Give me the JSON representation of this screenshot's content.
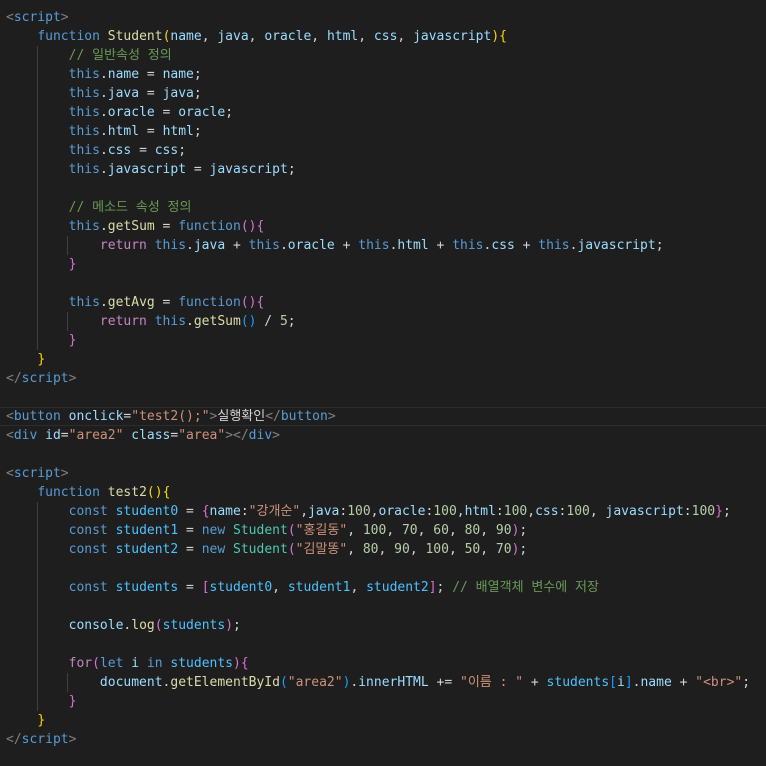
{
  "editor": {
    "language": "html",
    "colors": {
      "background": "#1e1e1e",
      "foreground": "#d4d4d4",
      "tag": "#569cd6",
      "bracket": "#808080",
      "keyword": "#569cd6",
      "control": "#c586c0",
      "function": "#dcdcaa",
      "type": "#4ec9b0",
      "variable": "#9cdcfe",
      "constant": "#4fc1ff",
      "string": "#ce9178",
      "number": "#b5cea8",
      "comment": "#6a9955",
      "paren1": "#ffd700",
      "paren2": "#da70d6",
      "paren3": "#179fff"
    },
    "lines": [
      {
        "indent": 0,
        "tokens": [
          [
            "br",
            "<"
          ],
          [
            "tag",
            "script"
          ],
          [
            "br",
            ">"
          ]
        ]
      },
      {
        "indent": 1,
        "tokens": [
          [
            "kw",
            "function "
          ],
          [
            "fn",
            "Student"
          ],
          [
            "p1",
            "("
          ],
          [
            "var",
            "name"
          ],
          [
            "op",
            ", "
          ],
          [
            "var",
            "java"
          ],
          [
            "op",
            ", "
          ],
          [
            "var",
            "oracle"
          ],
          [
            "op",
            ", "
          ],
          [
            "var",
            "html"
          ],
          [
            "op",
            ", "
          ],
          [
            "var",
            "css"
          ],
          [
            "op",
            ", "
          ],
          [
            "var",
            "javascript"
          ],
          [
            "p1",
            ")"
          ],
          [
            "p1",
            "{"
          ]
        ]
      },
      {
        "indent": 2,
        "tokens": [
          [
            "cmt",
            "// 일반속성 정의"
          ]
        ]
      },
      {
        "indent": 2,
        "tokens": [
          [
            "kw",
            "this"
          ],
          [
            "op",
            "."
          ],
          [
            "var",
            "name"
          ],
          [
            "op",
            " = "
          ],
          [
            "var",
            "name"
          ],
          [
            "op",
            ";"
          ]
        ]
      },
      {
        "indent": 2,
        "tokens": [
          [
            "kw",
            "this"
          ],
          [
            "op",
            "."
          ],
          [
            "var",
            "java"
          ],
          [
            "op",
            " = "
          ],
          [
            "var",
            "java"
          ],
          [
            "op",
            ";"
          ]
        ]
      },
      {
        "indent": 2,
        "tokens": [
          [
            "kw",
            "this"
          ],
          [
            "op",
            "."
          ],
          [
            "var",
            "oracle"
          ],
          [
            "op",
            " = "
          ],
          [
            "var",
            "oracle"
          ],
          [
            "op",
            ";"
          ]
        ]
      },
      {
        "indent": 2,
        "tokens": [
          [
            "kw",
            "this"
          ],
          [
            "op",
            "."
          ],
          [
            "var",
            "html"
          ],
          [
            "op",
            " = "
          ],
          [
            "var",
            "html"
          ],
          [
            "op",
            ";"
          ]
        ]
      },
      {
        "indent": 2,
        "tokens": [
          [
            "kw",
            "this"
          ],
          [
            "op",
            "."
          ],
          [
            "var",
            "css"
          ],
          [
            "op",
            " = "
          ],
          [
            "var",
            "css"
          ],
          [
            "op",
            ";"
          ]
        ]
      },
      {
        "indent": 2,
        "tokens": [
          [
            "kw",
            "this"
          ],
          [
            "op",
            "."
          ],
          [
            "var",
            "javascript"
          ],
          [
            "op",
            " = "
          ],
          [
            "var",
            "javascript"
          ],
          [
            "op",
            ";"
          ]
        ]
      },
      {
        "indent": 2,
        "tokens": []
      },
      {
        "indent": 2,
        "tokens": [
          [
            "cmt",
            "// 메소드 속성 정의"
          ]
        ]
      },
      {
        "indent": 2,
        "tokens": [
          [
            "kw",
            "this"
          ],
          [
            "op",
            "."
          ],
          [
            "fn",
            "getSum"
          ],
          [
            "op",
            " = "
          ],
          [
            "kw",
            "function"
          ],
          [
            "p2",
            "("
          ],
          [
            "p2",
            ")"
          ],
          [
            "p2",
            "{"
          ]
        ]
      },
      {
        "indent": 3,
        "tokens": [
          [
            "ctl",
            "return "
          ],
          [
            "kw",
            "this"
          ],
          [
            "op",
            "."
          ],
          [
            "var",
            "java"
          ],
          [
            "op",
            " + "
          ],
          [
            "kw",
            "this"
          ],
          [
            "op",
            "."
          ],
          [
            "var",
            "oracle"
          ],
          [
            "op",
            " + "
          ],
          [
            "kw",
            "this"
          ],
          [
            "op",
            "."
          ],
          [
            "var",
            "html"
          ],
          [
            "op",
            " + "
          ],
          [
            "kw",
            "this"
          ],
          [
            "op",
            "."
          ],
          [
            "var",
            "css"
          ],
          [
            "op",
            " + "
          ],
          [
            "kw",
            "this"
          ],
          [
            "op",
            "."
          ],
          [
            "var",
            "javascript"
          ],
          [
            "op",
            ";"
          ]
        ]
      },
      {
        "indent": 2,
        "tokens": [
          [
            "p2",
            "}"
          ]
        ]
      },
      {
        "indent": 2,
        "tokens": []
      },
      {
        "indent": 2,
        "tokens": [
          [
            "kw",
            "this"
          ],
          [
            "op",
            "."
          ],
          [
            "fn",
            "getAvg"
          ],
          [
            "op",
            " = "
          ],
          [
            "kw",
            "function"
          ],
          [
            "p2",
            "("
          ],
          [
            "p2",
            ")"
          ],
          [
            "p2",
            "{"
          ]
        ]
      },
      {
        "indent": 3,
        "tokens": [
          [
            "ctl",
            "return "
          ],
          [
            "kw",
            "this"
          ],
          [
            "op",
            "."
          ],
          [
            "fn",
            "getSum"
          ],
          [
            "p3",
            "("
          ],
          [
            "p3",
            ")"
          ],
          [
            "op",
            " / "
          ],
          [
            "num",
            "5"
          ],
          [
            "op",
            ";"
          ]
        ]
      },
      {
        "indent": 2,
        "tokens": [
          [
            "p2",
            "}"
          ]
        ]
      },
      {
        "indent": 1,
        "tokens": [
          [
            "p1",
            "}"
          ]
        ]
      },
      {
        "indent": 0,
        "tokens": [
          [
            "br",
            "</"
          ],
          [
            "tag",
            "script"
          ],
          [
            "br",
            ">"
          ]
        ]
      },
      {
        "indent": 0,
        "tokens": []
      },
      {
        "indent": 0,
        "current": true,
        "tokens": [
          [
            "br",
            "<"
          ],
          [
            "tag",
            "button"
          ],
          [
            "op",
            " "
          ],
          [
            "attr",
            "onclick"
          ],
          [
            "op",
            "="
          ],
          [
            "str",
            "\"test2();\""
          ],
          [
            "br",
            ">"
          ],
          [
            "op",
            "실행확인"
          ],
          [
            "br",
            "</"
          ],
          [
            "tag",
            "button"
          ],
          [
            "br",
            ">"
          ]
        ]
      },
      {
        "indent": 0,
        "tokens": [
          [
            "br",
            "<"
          ],
          [
            "tag",
            "div"
          ],
          [
            "op",
            " "
          ],
          [
            "attr",
            "id"
          ],
          [
            "op",
            "="
          ],
          [
            "str",
            "\"area2\""
          ],
          [
            "op",
            " "
          ],
          [
            "attr",
            "class"
          ],
          [
            "op",
            "="
          ],
          [
            "str",
            "\"area\""
          ],
          [
            "br",
            "></"
          ],
          [
            "tag",
            "div"
          ],
          [
            "br",
            ">"
          ]
        ]
      },
      {
        "indent": 0,
        "tokens": []
      },
      {
        "indent": 0,
        "tokens": [
          [
            "br",
            "<"
          ],
          [
            "tag",
            "script"
          ],
          [
            "br",
            ">"
          ]
        ]
      },
      {
        "indent": 1,
        "tokens": [
          [
            "kw",
            "function "
          ],
          [
            "fn",
            "test2"
          ],
          [
            "p1",
            "("
          ],
          [
            "p1",
            ")"
          ],
          [
            "p1",
            "{"
          ]
        ]
      },
      {
        "indent": 2,
        "tokens": [
          [
            "kw",
            "const "
          ],
          [
            "const",
            "student0"
          ],
          [
            "op",
            " = "
          ],
          [
            "p2",
            "{"
          ],
          [
            "var",
            "name"
          ],
          [
            "op",
            ":"
          ],
          [
            "str",
            "\"강개순\""
          ],
          [
            "op",
            ","
          ],
          [
            "var",
            "java"
          ],
          [
            "op",
            ":"
          ],
          [
            "num",
            "100"
          ],
          [
            "op",
            ","
          ],
          [
            "var",
            "oracle"
          ],
          [
            "op",
            ":"
          ],
          [
            "num",
            "100"
          ],
          [
            "op",
            ","
          ],
          [
            "var",
            "html"
          ],
          [
            "op",
            ":"
          ],
          [
            "num",
            "100"
          ],
          [
            "op",
            ","
          ],
          [
            "var",
            "css"
          ],
          [
            "op",
            ":"
          ],
          [
            "num",
            "100"
          ],
          [
            "op",
            ", "
          ],
          [
            "var",
            "javascript"
          ],
          [
            "op",
            ":"
          ],
          [
            "num",
            "100"
          ],
          [
            "p2",
            "}"
          ],
          [
            "op",
            ";"
          ]
        ]
      },
      {
        "indent": 2,
        "tokens": [
          [
            "kw",
            "const "
          ],
          [
            "const",
            "student1"
          ],
          [
            "op",
            " = "
          ],
          [
            "kw",
            "new "
          ],
          [
            "type",
            "Student"
          ],
          [
            "p2",
            "("
          ],
          [
            "str",
            "\"홍길동\""
          ],
          [
            "op",
            ", "
          ],
          [
            "num",
            "100"
          ],
          [
            "op",
            ", "
          ],
          [
            "num",
            "70"
          ],
          [
            "op",
            ", "
          ],
          [
            "num",
            "60"
          ],
          [
            "op",
            ", "
          ],
          [
            "num",
            "80"
          ],
          [
            "op",
            ", "
          ],
          [
            "num",
            "90"
          ],
          [
            "p2",
            ")"
          ],
          [
            "op",
            ";"
          ]
        ]
      },
      {
        "indent": 2,
        "tokens": [
          [
            "kw",
            "const "
          ],
          [
            "const",
            "student2"
          ],
          [
            "op",
            " = "
          ],
          [
            "kw",
            "new "
          ],
          [
            "type",
            "Student"
          ],
          [
            "p2",
            "("
          ],
          [
            "str",
            "\"김말똥\""
          ],
          [
            "op",
            ", "
          ],
          [
            "num",
            "80"
          ],
          [
            "op",
            ", "
          ],
          [
            "num",
            "90"
          ],
          [
            "op",
            ", "
          ],
          [
            "num",
            "100"
          ],
          [
            "op",
            ", "
          ],
          [
            "num",
            "50"
          ],
          [
            "op",
            ", "
          ],
          [
            "num",
            "70"
          ],
          [
            "p2",
            ")"
          ],
          [
            "op",
            ";"
          ]
        ]
      },
      {
        "indent": 2,
        "tokens": []
      },
      {
        "indent": 2,
        "tokens": [
          [
            "kw",
            "const "
          ],
          [
            "const",
            "students"
          ],
          [
            "op",
            " = "
          ],
          [
            "p2",
            "["
          ],
          [
            "const",
            "student0"
          ],
          [
            "op",
            ", "
          ],
          [
            "const",
            "student1"
          ],
          [
            "op",
            ", "
          ],
          [
            "const",
            "student2"
          ],
          [
            "p2",
            "]"
          ],
          [
            "op",
            "; "
          ],
          [
            "cmt",
            "// 배열객체 변수에 저장"
          ]
        ]
      },
      {
        "indent": 2,
        "tokens": []
      },
      {
        "indent": 2,
        "tokens": [
          [
            "var",
            "console"
          ],
          [
            "op",
            "."
          ],
          [
            "fn",
            "log"
          ],
          [
            "p2",
            "("
          ],
          [
            "const",
            "students"
          ],
          [
            "p2",
            ")"
          ],
          [
            "op",
            ";"
          ]
        ]
      },
      {
        "indent": 2,
        "tokens": []
      },
      {
        "indent": 2,
        "tokens": [
          [
            "ctl",
            "for"
          ],
          [
            "p2",
            "("
          ],
          [
            "kw",
            "let "
          ],
          [
            "var",
            "i"
          ],
          [
            "op",
            " "
          ],
          [
            "kw",
            "in "
          ],
          [
            "const",
            "students"
          ],
          [
            "p2",
            ")"
          ],
          [
            "p2",
            "{"
          ]
        ]
      },
      {
        "indent": 3,
        "tokens": [
          [
            "var",
            "document"
          ],
          [
            "op",
            "."
          ],
          [
            "fn",
            "getElementById"
          ],
          [
            "p3",
            "("
          ],
          [
            "str",
            "\"area2\""
          ],
          [
            "p3",
            ")"
          ],
          [
            "op",
            "."
          ],
          [
            "var",
            "innerHTML"
          ],
          [
            "op",
            " += "
          ],
          [
            "str",
            "\"이름 : \""
          ],
          [
            "op",
            " + "
          ],
          [
            "const",
            "students"
          ],
          [
            "p3",
            "["
          ],
          [
            "var",
            "i"
          ],
          [
            "p3",
            "]"
          ],
          [
            "op",
            "."
          ],
          [
            "var",
            "name"
          ],
          [
            "op",
            " + "
          ],
          [
            "str",
            "\"<br>\""
          ],
          [
            "op",
            ";"
          ]
        ]
      },
      {
        "indent": 2,
        "tokens": [
          [
            "p2",
            "}"
          ]
        ]
      },
      {
        "indent": 1,
        "tokens": [
          [
            "p1",
            "}"
          ]
        ]
      },
      {
        "indent": 0,
        "tokens": [
          [
            "br",
            "</"
          ],
          [
            "tag",
            "script"
          ],
          [
            "br",
            ">"
          ]
        ]
      }
    ]
  }
}
